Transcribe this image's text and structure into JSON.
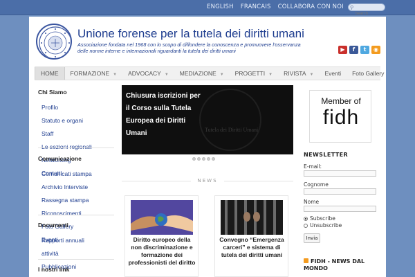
{
  "topbar": {
    "links": [
      "ENGLISH",
      "FRANCAIS",
      "COLLABORA CON NOI"
    ],
    "search_placeholder": "Search"
  },
  "header": {
    "title": "Unione forense per la tutela dei diritti umani",
    "tagline": "Associazione fondata nel 1968 con lo scopo di diffondere la conoscenza e promuovere l'osservanza delle norme interne e internazionali riguardanti la tutela dei diritti umani",
    "social": [
      {
        "name": "youtube-icon",
        "color": "#c9302c",
        "glyph": "▶"
      },
      {
        "name": "facebook-icon",
        "color": "#3b5998",
        "glyph": "f"
      },
      {
        "name": "twitter-icon",
        "color": "#4fa8e0",
        "glyph": "t"
      },
      {
        "name": "rss-icon",
        "color": "#f39b1f",
        "glyph": "◉"
      }
    ]
  },
  "nav": {
    "items": [
      {
        "label": "HOME",
        "caret": false
      },
      {
        "label": "FORMAZIONE",
        "caret": true
      },
      {
        "label": "ADVOCACY",
        "caret": true
      },
      {
        "label": "MEDIAZIONE",
        "caret": true
      },
      {
        "label": "PROGETTI",
        "caret": true
      },
      {
        "label": "RIVISTA",
        "caret": true
      },
      {
        "label": "Eventi",
        "caret": false
      },
      {
        "label": "Foto Gallery",
        "caret": false
      }
    ]
  },
  "left_sidebar": {
    "chi_siamo": {
      "title": "Chi Siamo",
      "links": [
        "Profilo",
        "Statuto e organi",
        "Staff",
        "Le sezioni regionali",
        "Networking",
        "Contatti"
      ]
    },
    "comunicazione": {
      "title": "Comunicazione",
      "links": [
        "Comunicati stampa",
        "Archivio Interviste",
        "Rassegna stampa",
        "Riconoscimenti",
        "Foto Gallery",
        "Eventi"
      ]
    },
    "documenti": {
      "title": "Documenti",
      "links": [
        "Rapporti annuali attività",
        "Pubblicazioni"
      ]
    },
    "nostri_link": {
      "title": "I nostri link"
    }
  },
  "slider": {
    "caption": "Chiusura iscrizioni per il Corso sulla Tutela Europea dei Diritti Umani",
    "background_text": "Tutela dei Diritti Umani",
    "dots": 5
  },
  "news": {
    "label": "NEWS",
    "cards": [
      {
        "title": "Diritto europeo della non discriminazione e formazione dei professionisti del diritto"
      },
      {
        "title": "Convegno “Emergenza carceri” e sistema di tutela dei diritti umani"
      }
    ]
  },
  "right_sidebar": {
    "fidh": {
      "member": "Member of",
      "brand": "fidh"
    },
    "newsletter": {
      "title": "NEWSLETTER",
      "email_label": "E-mail:",
      "cognome_label": "Cognome",
      "nome_label": "Nome",
      "subscribe_label": "Subscribe",
      "unsubscribe_label": "Unsubscribe",
      "submit_label": "Invia"
    },
    "feed_title": "FIDH - NEWS DAL MONDO"
  }
}
